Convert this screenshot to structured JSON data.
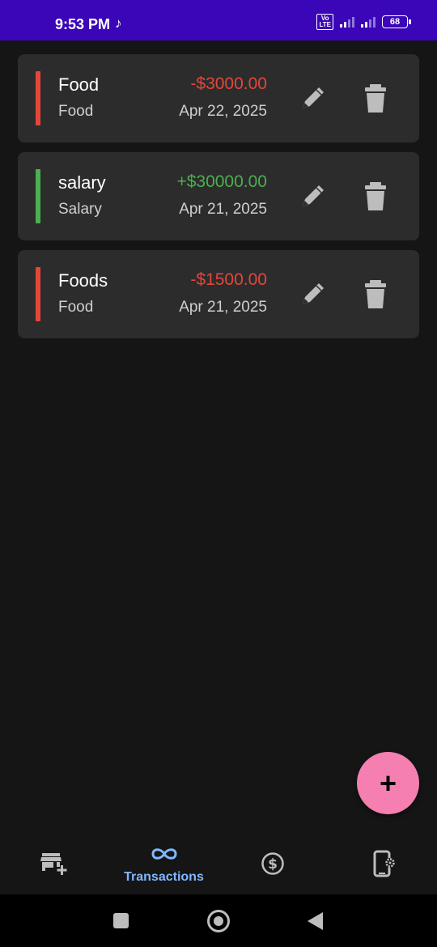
{
  "status_bar": {
    "time": "9:53 PM",
    "volte_label": "Vo\nLTE",
    "battery": "68"
  },
  "transactions": [
    {
      "title": "Food",
      "category": "Food",
      "amount": "-$3000.00",
      "date": "Apr 22, 2025",
      "type": "expense"
    },
    {
      "title": "salary",
      "category": "Salary",
      "amount": "+$30000.00",
      "date": "Apr 21, 2025",
      "type": "income"
    },
    {
      "title": "Foods",
      "category": "Food",
      "amount": "-$1500.00",
      "date": "Apr 21, 2025",
      "type": "expense"
    }
  ],
  "colors": {
    "expense": "#e5463b",
    "income": "#4caf50",
    "accent": "#7fb8ff",
    "fab": "#f47fb0",
    "status_bar": "#3a06b8"
  },
  "fab": {
    "icon": "plus-icon",
    "label": "+"
  },
  "bottom_nav": {
    "items": [
      {
        "icon": "store-add-icon",
        "label": ""
      },
      {
        "icon": "infinity-icon",
        "label": "Transactions",
        "active": true
      },
      {
        "icon": "dollar-circle-icon",
        "label": ""
      },
      {
        "icon": "phone-settings-icon",
        "label": ""
      }
    ]
  }
}
